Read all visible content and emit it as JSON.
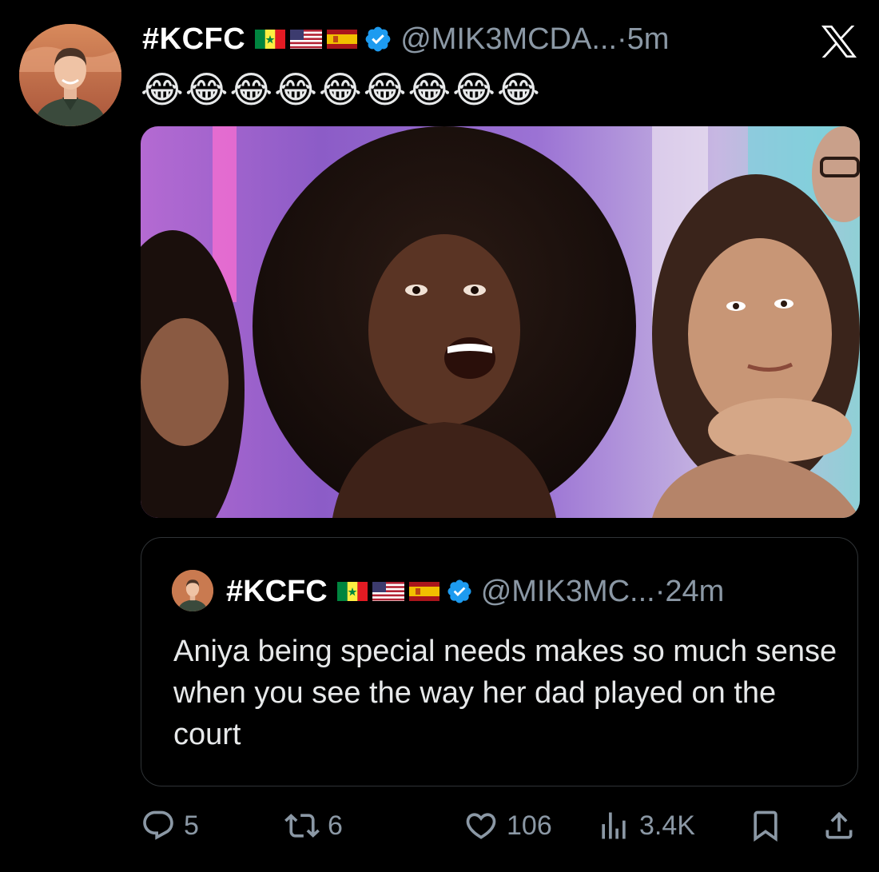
{
  "tweet": {
    "display_name": "#KCFC",
    "handle": "@MIK3MCDA...",
    "separator": "·",
    "time": "5m",
    "emoji_text": "😂😂😂😂😂😂😂😂😂",
    "flags": [
      "senegal-flag",
      "usa-flag",
      "spain-flag"
    ],
    "verified_color": "#1d9bf0"
  },
  "quoted": {
    "display_name": "#KCFC",
    "handle": "@MIK3MC...",
    "separator": "·",
    "time": "24m",
    "text": "Aniya being special needs makes so much sense when you see the way her dad played on the court"
  },
  "actions": {
    "replies": "5",
    "reposts": "6",
    "likes": "106",
    "views": "3.4K"
  },
  "colors": {
    "background": "#000000",
    "text_primary": "#e7e9ea",
    "text_secondary": "#8b98a5",
    "border": "#2f3336"
  }
}
